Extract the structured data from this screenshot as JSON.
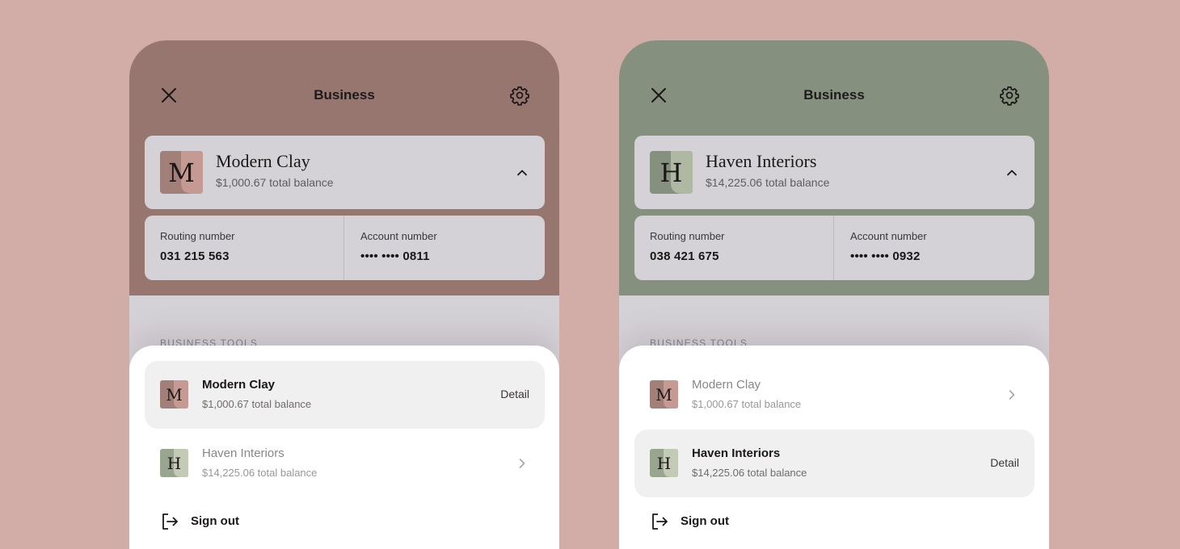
{
  "screens": [
    {
      "header": {
        "title": "Business"
      },
      "account": {
        "name": "Modern Clay",
        "initial": "M",
        "balance": "$1,000.67 total balance",
        "logo_colors": [
          "#a27f79",
          "#c49a93"
        ]
      },
      "numbers": {
        "routing_label": "Routing number",
        "routing_value": "031 215 563",
        "account_label": "Account number",
        "account_value": "•••• •••• 0811"
      },
      "section_label": "BUSINESS TOOLS",
      "businesses": [
        {
          "initial": "M",
          "name": "Modern Clay",
          "balance": "$1,000.67 total balance",
          "selected": true,
          "action": "Detail",
          "logo_colors": [
            "#a27f79",
            "#c49a93"
          ]
        },
        {
          "initial": "H",
          "name": "Haven Interiors",
          "balance": "$14,225.06 total balance",
          "selected": false,
          "action": "",
          "logo_colors": [
            "#9aa58f",
            "#c3cbb7"
          ]
        }
      ],
      "signout_label": "Sign out"
    },
    {
      "header": {
        "title": "Business"
      },
      "account": {
        "name": "Haven Interiors",
        "initial": "H",
        "balance": "$14,225.06 total balance",
        "logo_colors": [
          "#86907f",
          "#aeb8a2"
        ]
      },
      "numbers": {
        "routing_label": "Routing number",
        "routing_value": "038 421 675",
        "account_label": "Account number",
        "account_value": "•••• •••• 0932"
      },
      "section_label": "BUSINESS TOOLS",
      "businesses": [
        {
          "initial": "M",
          "name": "Modern Clay",
          "balance": "$1,000.67 total balance",
          "selected": false,
          "action": "",
          "logo_colors": [
            "#a27f79",
            "#c49a93"
          ]
        },
        {
          "initial": "H",
          "name": "Haven Interiors",
          "balance": "$14,225.06 total balance",
          "selected": true,
          "action": "Detail",
          "logo_colors": [
            "#9aa58f",
            "#c3cbb7"
          ]
        }
      ],
      "signout_label": "Sign out"
    }
  ],
  "colors": {
    "background": "#d2aca7",
    "clay_header": "#977670",
    "haven_header": "#86907f",
    "card": "#d5d2d7",
    "sheet": "#ffffff",
    "selected_row": "#f1f0f1"
  },
  "icons": {
    "close": "close-icon",
    "settings": "gear-icon",
    "collapse": "chevron-up-icon",
    "row_next": "chevron-right-icon",
    "signout": "sign-out-icon"
  }
}
